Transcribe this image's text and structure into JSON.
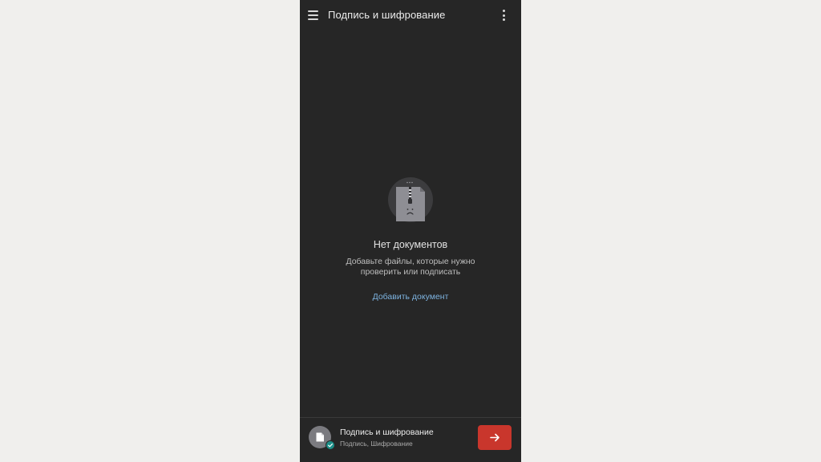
{
  "app": {
    "title": "Подпись и шифрование",
    "menu_icon": "hamburger-menu-icon",
    "more_icon": "more-vertical-icon"
  },
  "empty_state": {
    "illustration_icon": "sad-zip-file-icon",
    "title": "Нет документов",
    "description": "Добавьте файлы, которые нужно проверить или подписать",
    "add_link": "Добавить документ"
  },
  "bottom_bar": {
    "title": "Подпись и шифрование",
    "subtitle": "Подпись, Шифрование",
    "avatar_icon": "document-icon",
    "badge_icon": "check-badge-icon",
    "action_icon": "arrow-right-icon"
  },
  "colors": {
    "background": "#262626",
    "accent_red": "#c9362c",
    "link_blue": "#7db3e0",
    "badge_teal": "#1d8f88"
  }
}
